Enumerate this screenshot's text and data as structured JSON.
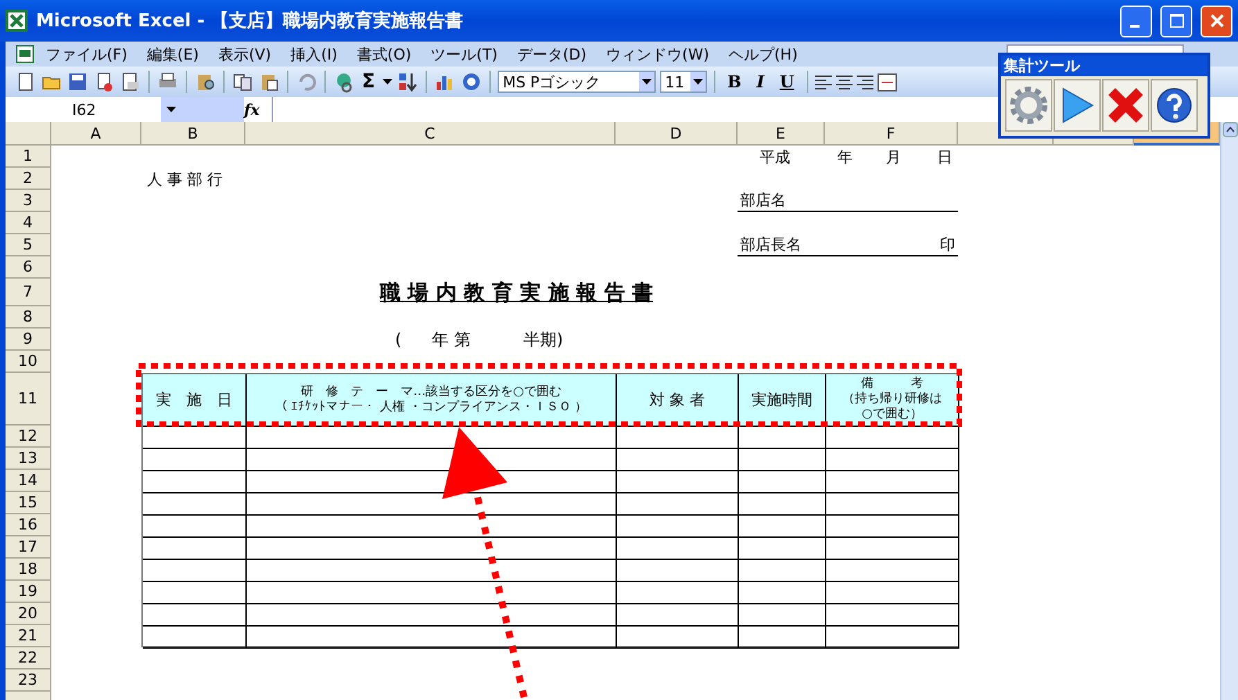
{
  "window": {
    "title": "Microsoft Excel - 【支店】職場内教育実施報告書"
  },
  "menu": [
    "ファイル(F)",
    "編集(E)",
    "表示(V)",
    "挿入(I)",
    "書式(O)",
    "ツール(T)",
    "データ(D)",
    "ウィンドウ(W)",
    "ヘルプ(H)"
  ],
  "toolbar": {
    "sum": "Σ",
    "font": "MS Pゴシック",
    "size": "11",
    "format_buttons": [
      "B",
      "I",
      "U"
    ]
  },
  "formula_bar": {
    "name_box": "I62",
    "function_label": "fx"
  },
  "sheet": {
    "columns": [
      {
        "label": "A",
        "selected": false
      },
      {
        "label": "B",
        "selected": false
      },
      {
        "label": "C",
        "selected": false
      },
      {
        "label": "D",
        "selected": false
      },
      {
        "label": "E",
        "selected": false
      },
      {
        "label": "F",
        "selected": false
      },
      {
        "selected": false
      },
      {
        "selected": false
      },
      {
        "selected": true
      }
    ],
    "rows": [
      "1",
      "2",
      "3",
      "4",
      "5",
      "6",
      "7",
      "8",
      "9",
      "10",
      "11",
      "12",
      "13",
      "14",
      "15",
      "16",
      "17",
      "18",
      "19",
      "20",
      "21",
      "22",
      "23"
    ]
  },
  "document": {
    "issuer": "人 事 部 行",
    "date": [
      "平成",
      "年",
      "月",
      "日"
    ],
    "branch_label": "部店名",
    "manager_label": "部店長名",
    "seal": "印",
    "title": "職 場 内 教 育 実 施 報 告 書",
    "period": [
      "(",
      "年 第",
      "半期)"
    ]
  },
  "table": {
    "headers": [
      [
        "実　施　日"
      ],
      [
        "研　修　テ　ー　マ…該当する区分を○で囲む",
        "（ ｴﾁｹｯﾄマナー・ 人権 ・コンプライアンス・ＩＳＯ ）"
      ],
      [
        "対 象 者"
      ],
      [
        "実施時間"
      ],
      [
        "備　　　考",
        "（持ち帰り研修は",
        "○で囲む）"
      ]
    ]
  },
  "floating_toolbar": {
    "title": "集計ツール"
  }
}
